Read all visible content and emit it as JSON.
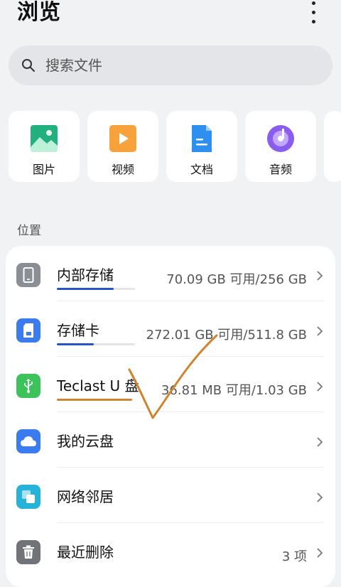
{
  "page": {
    "title": "浏览",
    "more_icon": "more-vertical-icon"
  },
  "search": {
    "placeholder": "搜索文件",
    "icon": "search-icon"
  },
  "categories": [
    {
      "label": "图片",
      "icon": "image-icon",
      "color": "#23b07f"
    },
    {
      "label": "视频",
      "icon": "video-icon",
      "color": "#f7a23b"
    },
    {
      "label": "文档",
      "icon": "document-icon",
      "color": "#2f8ff0"
    },
    {
      "label": "音频",
      "icon": "audio-icon",
      "color": "#8b5cf0"
    }
  ],
  "locations": {
    "section_label": "位置",
    "items": [
      {
        "name": "内部存储",
        "detail": "70.09 GB 可用/256 GB",
        "icon": "phone-icon",
        "color": "#8a8f96",
        "used_fraction": 0.73
      },
      {
        "name": "存储卡",
        "detail": "272.01 GB 可用/511.8 GB",
        "icon": "sd-card-icon",
        "color": "#3a7bf0",
        "used_fraction": 0.47
      },
      {
        "name": "Teclast U 盘",
        "detail": "36.81 MB 可用/1.03 GB",
        "icon": "usb-icon",
        "color": "#3cc45a"
      },
      {
        "name": "我的云盘",
        "detail": "",
        "icon": "cloud-icon",
        "color": "#3a7bf0"
      },
      {
        "name": "网络邻居",
        "detail": "",
        "icon": "network-icon",
        "color": "#27b3d8"
      },
      {
        "name": "最近删除",
        "detail": "3 项",
        "icon": "trash-icon",
        "color": "#707479"
      }
    ]
  },
  "annotation": {
    "ink_color": "#d0842d",
    "mark_icon": "handwritten-checkmark-icon"
  }
}
